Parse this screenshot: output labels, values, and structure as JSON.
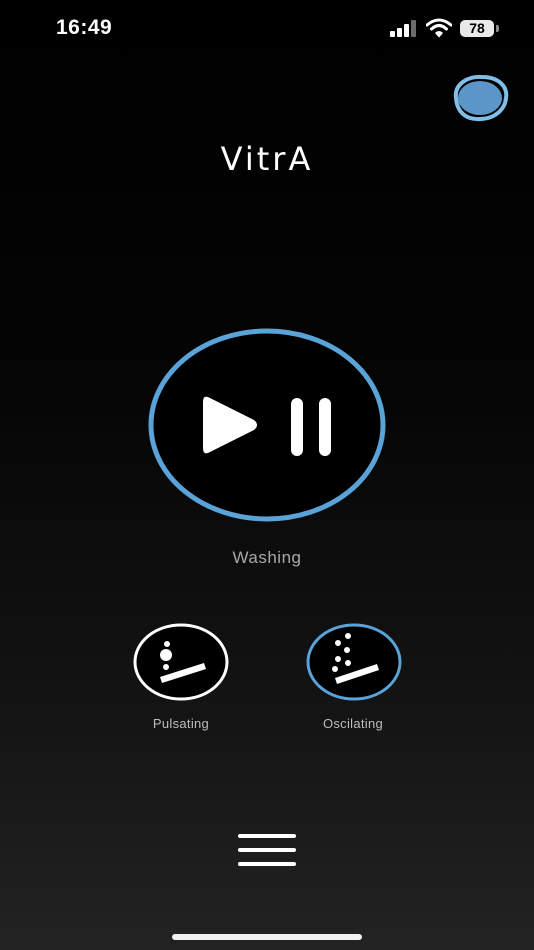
{
  "status_bar": {
    "time": "16:49",
    "battery_level": "78",
    "icons": [
      "cellular-signal-icon",
      "wifi-icon",
      "battery-icon"
    ]
  },
  "header": {
    "logo_text": "VitrA",
    "profile_blob_icon": "blue-blob-icon"
  },
  "main": {
    "play_pause_icon": "play-pause-icon",
    "state_label": "Washing"
  },
  "modes": [
    {
      "label": "Pulsating",
      "icon": "pulsating-spray-icon",
      "selected": false
    },
    {
      "label": "Oscilating",
      "icon": "oscillating-spray-icon",
      "selected": true
    }
  ],
  "footer": {
    "menu_icon": "hamburger-menu-icon"
  },
  "colors": {
    "accent_blue": "#5aa3d8",
    "blob_blue": "#5c95c7",
    "text_primary": "#ffffff",
    "text_secondary": "#a8a8a8",
    "background_top": "#000000",
    "background_bottom": "#232323"
  }
}
